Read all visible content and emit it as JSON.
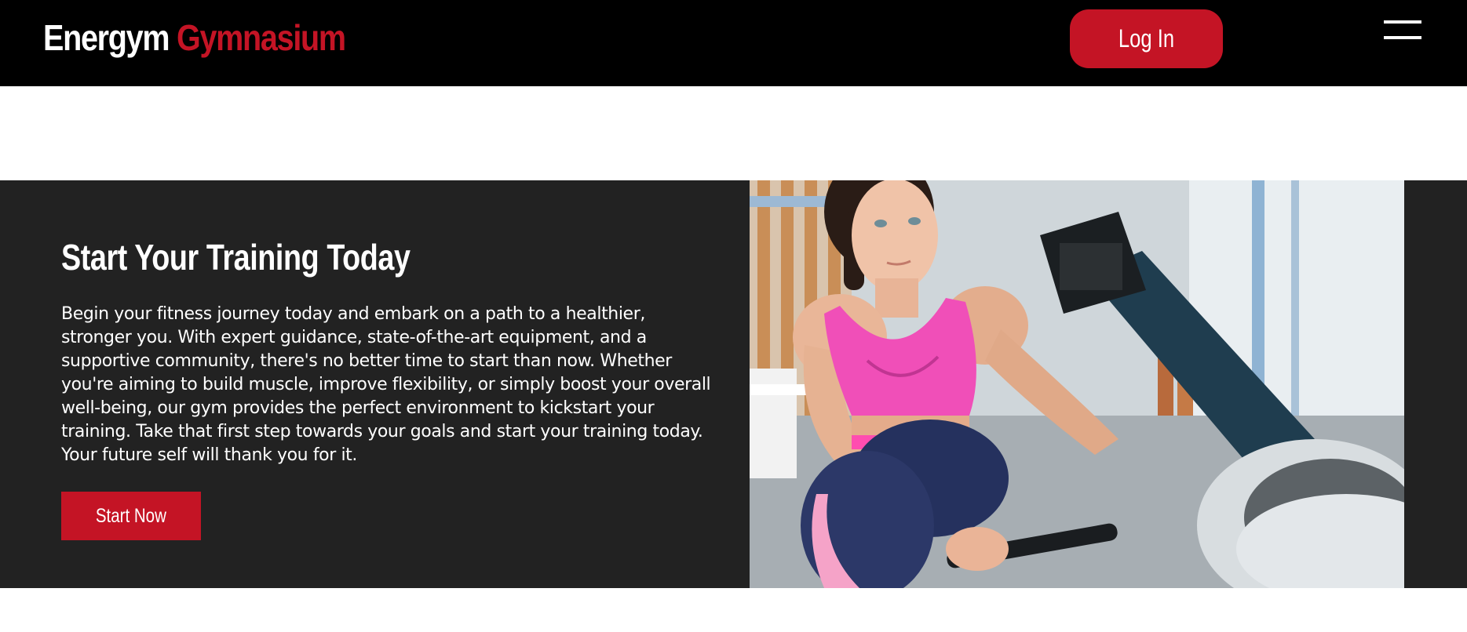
{
  "header": {
    "brand_primary": "Energym",
    "brand_secondary": "Gymnasium",
    "login_label": "Log In",
    "menu_icon": "hamburger-menu-icon"
  },
  "hero": {
    "title": "Start Your Training Today",
    "body": "Begin your fitness journey today and embark on a path to a healthier, stronger you. With expert guidance, state-of-the-art equipment, and a supportive community, there's no better time to start than now. Whether you're aiming to build muscle, improve flexibility, or simply boost your overall well-being, our gym provides the perfect environment to kickstart your training. Take that first step towards your goals and start your training today. Your future self will thank you for it.",
    "cta_label": "Start Now",
    "image_alt": "Woman in pink top training on a rowing machine"
  },
  "colors": {
    "accent": "#c41425",
    "navbar_bg": "#000000",
    "hero_bg": "#222222",
    "page_bg": "#ffffff"
  }
}
